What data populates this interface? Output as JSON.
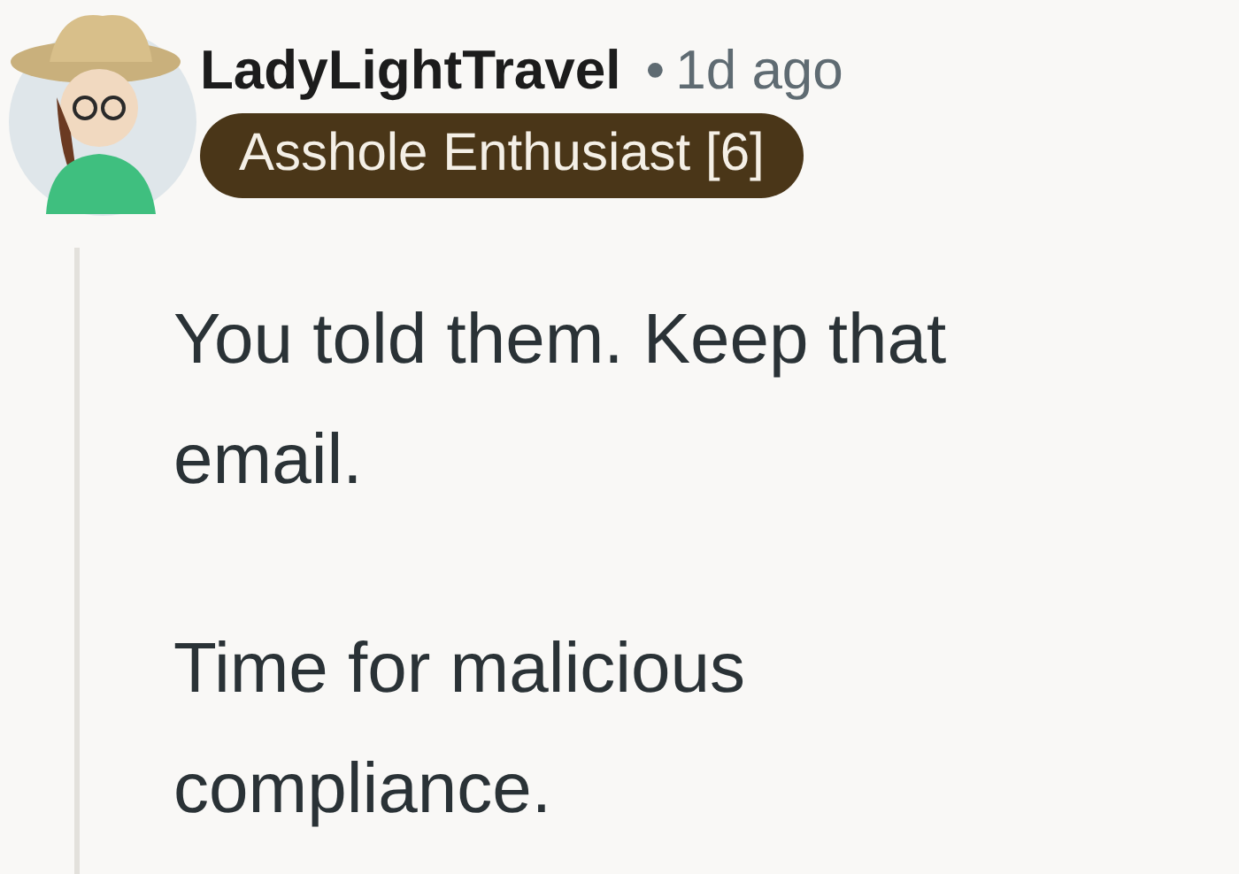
{
  "comment": {
    "author": "LadyLightTravel",
    "separator": "•",
    "time": "1d ago",
    "flair": "Asshole Enthusiast [6]",
    "paragraphs": [
      "You told them. Keep that email.",
      "Time for malicious compliance."
    ]
  }
}
